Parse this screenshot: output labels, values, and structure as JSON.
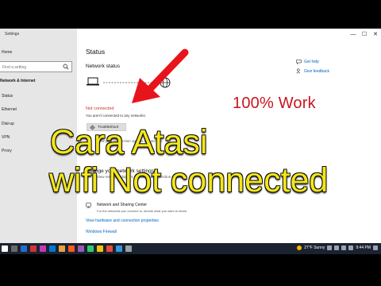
{
  "window": {
    "app_title": "Settings",
    "controls": [
      "—",
      "☐",
      "✕"
    ]
  },
  "sidebar": {
    "home": "Home",
    "search_placeholder": "Find a setting",
    "heading": "Network & Internet",
    "items": [
      {
        "label": "Status"
      },
      {
        "label": "Ethernet"
      },
      {
        "label": "Dial-up"
      },
      {
        "label": "VPN"
      },
      {
        "label": "Proxy"
      }
    ]
  },
  "main": {
    "title": "Status",
    "subtitle": "Network status",
    "error_title": "Not connected",
    "error_desc": "You aren't connected to any networks.",
    "troubleshoot": "Troubleshoot",
    "view_options_label": "View your connection options around you.",
    "adv_heading": "Change your network settings",
    "adv_line": "View network adapters and change connection settings.",
    "nsc_title": "Network and Sharing Center",
    "nsc_desc": "For the networks you connect to, decide what you want to share.",
    "link_hw": "View hardware and connection properties",
    "link_fw": "Windows Firewall"
  },
  "help": {
    "get_help": "Get help",
    "give_feedback": "Give feedback"
  },
  "overlay": {
    "badge": "100% Work",
    "line1": "Cara Atasi",
    "line2": "wifi Not connected",
    "badge_color": "#c8161d",
    "text_color": "#f3e61a"
  },
  "taskbar": {
    "weather": "27°F  Sunny",
    "time": "9:44 PM"
  },
  "colors": {
    "link": "#0067c0",
    "error": "#c0392b",
    "arrow": "#e8141b"
  }
}
